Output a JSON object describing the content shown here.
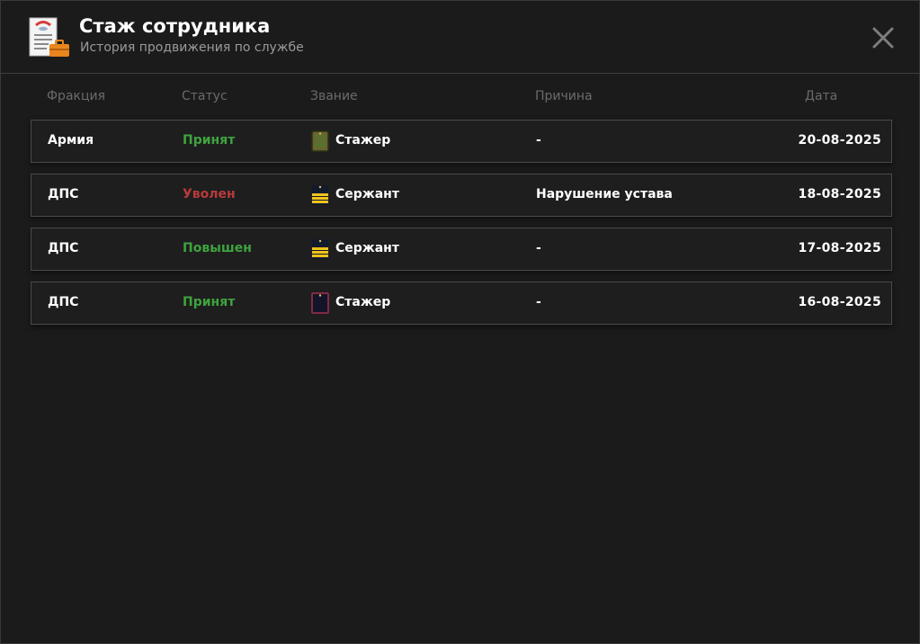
{
  "header": {
    "title": "Стаж сотрудника",
    "subtitle": "История продвижения по службе"
  },
  "columns": {
    "faction": "Фракция",
    "status": "Статус",
    "rank": "Звание",
    "reason": "Причина",
    "date": "Дата"
  },
  "colors": {
    "accepted": "#3ea33e",
    "fired": "#b83a3a",
    "promoted": "#3ea33e",
    "stripe": "#f2c21b"
  },
  "rows": [
    {
      "faction": "Армия",
      "status": "Принят",
      "status_type": "accepted",
      "rank": "Стажер",
      "rank_icon": "army-trainee-insignia-icon",
      "reason": "-",
      "date": "20-08-2025"
    },
    {
      "faction": "ДПС",
      "status": "Уволен",
      "status_type": "fired",
      "rank": "Сержант",
      "rank_icon": "sergeant-insignia-icon",
      "reason": "Нарушение устава",
      "date": "18-08-2025"
    },
    {
      "faction": "ДПС",
      "status": "Повышен",
      "status_type": "promoted",
      "rank": "Сержант",
      "rank_icon": "sergeant-insignia-icon",
      "reason": "-",
      "date": "17-08-2025"
    },
    {
      "faction": "ДПС",
      "status": "Принят",
      "status_type": "accepted",
      "rank": "Стажер",
      "rank_icon": "trainee-insignia-icon",
      "reason": "-",
      "date": "16-08-2025"
    }
  ]
}
